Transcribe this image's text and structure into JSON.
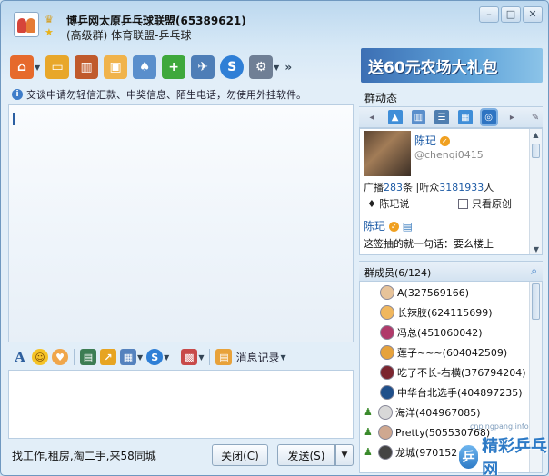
{
  "window": {
    "title_line1": "博乒网太原乒乓球联盟(65389621)",
    "title_line2": "(高级群) 体育联盟-乒乓球",
    "buttons": [
      "min-icon",
      "max-icon",
      "close-icon"
    ]
  },
  "toolbar": {
    "icons": [
      "home-icon",
      "folder-icon",
      "film-icon",
      "window-icon",
      "apps-icon",
      "add-icon",
      "tools-icon",
      "sogou-icon",
      "settings-icon"
    ],
    "more_label": "»"
  },
  "ad_banner": {
    "text": "送60元农场大礼包"
  },
  "notice": {
    "text": "交谈中请勿轻信汇款、中奖信息、陌生电话，勿使用外挂软件。"
  },
  "format_bar": {
    "icons": [
      "font-icon",
      "emoji-icon",
      "gift-face-icon",
      "image-icon",
      "send-file-icon",
      "screenshot-icon",
      "sogou-input-icon",
      "apps-icon"
    ],
    "history_label": "消息记录"
  },
  "bottom": {
    "ad_text": "找工作,租房,淘二手,来58同城",
    "close_label": "关闭(C)",
    "send_label": "发送(S)"
  },
  "right_panel": {
    "title": "群动态",
    "feed": {
      "name": "陈玘",
      "handle": "@chenqi0415",
      "broadcast_label": "广播",
      "broadcast_count": "283",
      "unit_1": "条 |听众",
      "listeners_count": "3181933",
      "unit_2": "人",
      "says": "陈玘说",
      "original_only": "只看原创",
      "post_name": "陈玘",
      "post_text": "这签抽的就一句话：要么楼上"
    },
    "members_title": "群成员(6/124)",
    "members": [
      {
        "name": "A(327569166)",
        "color": "#e7c39a"
      },
      {
        "name": "长辣胶(624115699)",
        "color": "#f0b75e"
      },
      {
        "name": "冯总(451060042)",
        "color": "#b03a6a"
      },
      {
        "name": "莲子~~~(604042509)",
        "color": "#e6a23c"
      },
      {
        "name": "吃了不长-右横(376794204)",
        "color": "#7b2630"
      },
      {
        "name": "中华台北选手(404897235)",
        "color": "#1f4f8a"
      },
      {
        "name": "海洋(404967085)",
        "color": "#d8d8d8"
      },
      {
        "name": "Pretty(505530768)",
        "color": "#cfa890"
      },
      {
        "name": "龙城(970152047)",
        "color": "#444444"
      }
    ]
  },
  "watermark": {
    "site": "cnpingpang.info",
    "logo": "精彩乒乓网"
  }
}
